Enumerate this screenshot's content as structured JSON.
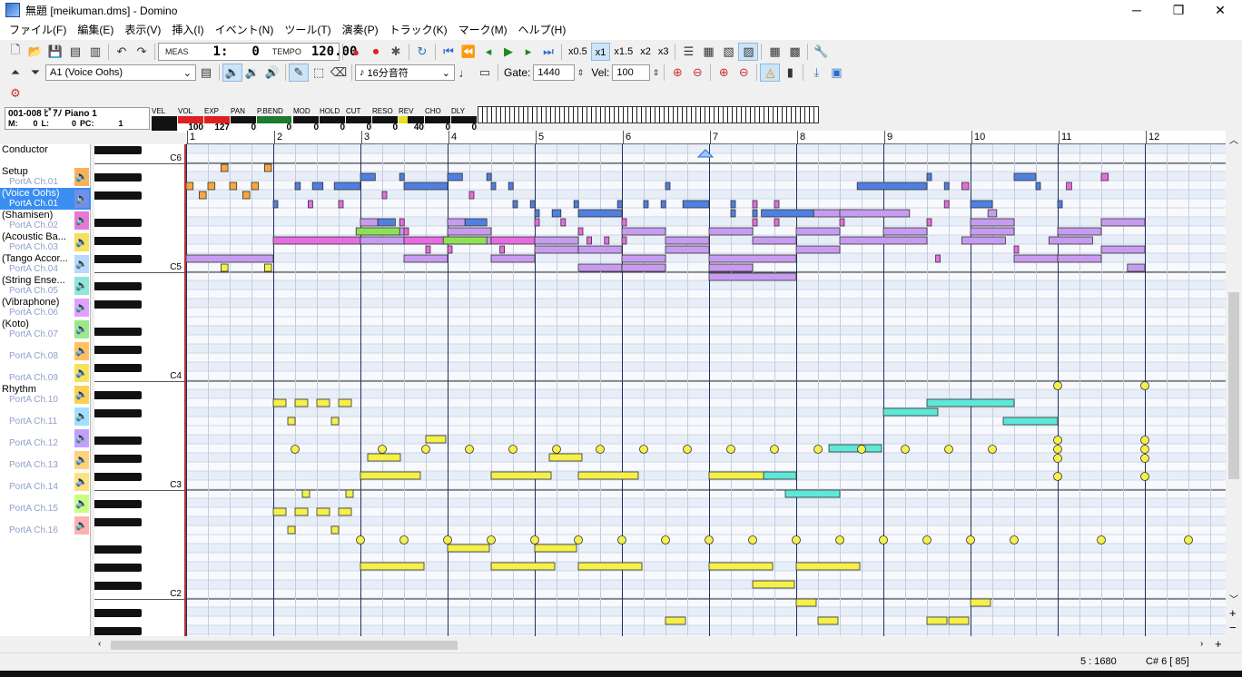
{
  "window": {
    "title": "無題 [meikuman.dms] - Domino",
    "minimize": "─",
    "maximize": "❐",
    "close": "✕"
  },
  "menu": [
    "ファイル(F)",
    "編集(E)",
    "表示(V)",
    "挿入(I)",
    "イベント(N)",
    "ツール(T)",
    "演奏(P)",
    "トラック(K)",
    "マーク(M)",
    "ヘルプ(H)"
  ],
  "toolbar": {
    "meas_label": "MEAS",
    "meas_value": "1:",
    "tick_value": "0",
    "tempo_label": "TEMPO",
    "tempo_value": "120.00",
    "speeds": [
      "x0.5",
      "x1",
      "x1.5",
      "x2",
      "x3"
    ],
    "speed_selected": "x1",
    "track_select": "A1  (Voice Oohs)",
    "note_length": "16分音符",
    "gate_label": "Gate:",
    "gate_value": "1440",
    "vel_label": "Vel:",
    "vel_value": "100"
  },
  "track_info": {
    "name": "001-008 ﾋﾟｱﾉ Piano 1",
    "m_label": "M:",
    "m": "0",
    "l_label": "L:",
    "l": "0",
    "pc_label": "PC:",
    "pc": "1"
  },
  "meters": [
    {
      "label": "VEL",
      "value": ""
    },
    {
      "label": "VOL",
      "value": "100"
    },
    {
      "label": "EXP",
      "value": "127"
    },
    {
      "label": "PAN",
      "value": "0"
    },
    {
      "label": "P.BEND",
      "value": "0"
    },
    {
      "label": "MOD",
      "value": "0"
    },
    {
      "label": "HOLD",
      "value": "0"
    },
    {
      "label": "CUT",
      "value": "0"
    },
    {
      "label": "RESO",
      "value": "0"
    },
    {
      "label": "REV",
      "value": "40"
    },
    {
      "label": "CHO",
      "value": "0"
    },
    {
      "label": "DLY",
      "value": "0"
    }
  ],
  "tracks": [
    {
      "name": "Conductor",
      "port": ""
    },
    {
      "name": "Setup",
      "port": "PortA  Ch.01"
    },
    {
      "name": "(Voice Oohs)",
      "port": "PortA  Ch.01",
      "selected": true
    },
    {
      "name": "(Shamisen)",
      "port": "PortA  Ch.02"
    },
    {
      "name": "(Acoustic Ba...",
      "port": "PortA  Ch.03"
    },
    {
      "name": "(Tango Accor...",
      "port": "PortA  Ch.04"
    },
    {
      "name": "(String Ense...",
      "port": "PortA  Ch.05"
    },
    {
      "name": "(Vibraphone)",
      "port": "PortA  Ch.06"
    },
    {
      "name": "(Koto)",
      "port": "PortA  Ch.07"
    },
    {
      "name": "",
      "port": "PortA  Ch.08"
    },
    {
      "name": "",
      "port": "PortA  Ch.09"
    },
    {
      "name": "Rhythm",
      "port": "PortA  Ch.10"
    },
    {
      "name": "",
      "port": "PortA  Ch.11"
    },
    {
      "name": "",
      "port": "PortA  Ch.12"
    },
    {
      "name": "",
      "port": "PortA  Ch.13"
    },
    {
      "name": "",
      "port": "PortA  Ch.14"
    },
    {
      "name": "",
      "port": "PortA  Ch.15"
    },
    {
      "name": "",
      "port": "PortA  Ch.16"
    }
  ],
  "track_colors": [
    "#ffffff",
    "#f5b25c",
    "#6f8fe8",
    "#e878d8",
    "#f5e060",
    "#b9d8ff",
    "#8ee8d8",
    "#e0a0ff",
    "#9ae88a",
    "#ffc060",
    "#f6e35b",
    "#ffd050",
    "#a0e0ff",
    "#c0a0ff",
    "#ffd27a",
    "#ffe080",
    "#c8ff80",
    "#ffb0b0"
  ],
  "octave_labels": [
    "C6",
    "C5",
    "C4",
    "C3",
    "C2"
  ],
  "measures": [
    "1",
    "2",
    "3",
    "4",
    "5",
    "6",
    "7",
    "8",
    "9",
    "10",
    "11",
    "12"
  ],
  "status": {
    "position": "5 : 1680",
    "note": "C# 6 [ 85]"
  },
  "colors": {
    "orange": "#f5a742",
    "blue": "#4f7fe0",
    "pink": "#e66ce0",
    "purple": "#c79cf0",
    "green": "#8ee05a",
    "cyan": "#5ee8d8",
    "yellow": "#f5f04a"
  },
  "notes": [
    {
      "row": 0,
      "m": 1.4,
      "len": 0.08,
      "c": "orange"
    },
    {
      "row": 0,
      "m": 1.9,
      "len": 0.08,
      "c": "orange"
    },
    {
      "row": 1,
      "m": 3.0,
      "len": 0.17,
      "c": "blue"
    },
    {
      "row": 1,
      "m": 3.45,
      "len": 0.05,
      "c": "blue"
    },
    {
      "row": 1,
      "m": 4.0,
      "len": 0.17,
      "c": "blue"
    },
    {
      "row": 1,
      "m": 4.45,
      "len": 0.05,
      "c": "blue"
    },
    {
      "row": 1,
      "m": 9.5,
      "len": 0.05,
      "c": "blue"
    },
    {
      "row": 1,
      "m": 10.5,
      "len": 0.25,
      "c": "blue"
    },
    {
      "row": 1,
      "m": 11.5,
      "len": 0.08,
      "c": "pink"
    },
    {
      "row": 2,
      "m": 1.0,
      "len": 0.08,
      "c": "orange"
    },
    {
      "row": 2,
      "m": 1.25,
      "len": 0.08,
      "c": "orange"
    },
    {
      "row": 2,
      "m": 1.5,
      "len": 0.08,
      "c": "orange"
    },
    {
      "row": 2,
      "m": 1.75,
      "len": 0.08,
      "c": "orange"
    },
    {
      "row": 2,
      "m": 2.25,
      "len": 0.06,
      "c": "blue"
    },
    {
      "row": 2,
      "m": 2.45,
      "len": 0.12,
      "c": "blue"
    },
    {
      "row": 2,
      "m": 2.7,
      "len": 0.3,
      "c": "blue"
    },
    {
      "row": 2,
      "m": 3.5,
      "len": 0.5,
      "c": "blue"
    },
    {
      "row": 2,
      "m": 4.5,
      "len": 0.05,
      "c": "blue"
    },
    {
      "row": 2,
      "m": 4.7,
      "len": 0.05,
      "c": "blue"
    },
    {
      "row": 2,
      "m": 6.5,
      "len": 0.05,
      "c": "blue"
    },
    {
      "row": 2,
      "m": 8.7,
      "len": 0.8,
      "c": "blue"
    },
    {
      "row": 2,
      "m": 9.7,
      "len": 0.05,
      "c": "blue"
    },
    {
      "row": 2,
      "m": 9.9,
      "len": 0.08,
      "c": "pink"
    },
    {
      "row": 2,
      "m": 10.75,
      "len": 0.05,
      "c": "blue"
    },
    {
      "row": 2,
      "m": 11.1,
      "len": 0.06,
      "c": "pink"
    },
    {
      "row": 3,
      "m": 1.15,
      "len": 0.08,
      "c": "orange"
    },
    {
      "row": 3,
      "m": 1.65,
      "len": 0.08,
      "c": "orange"
    },
    {
      "row": 3,
      "m": 3.25,
      "len": 0.05,
      "c": "pink"
    },
    {
      "row": 3,
      "m": 4.25,
      "len": 0.05,
      "c": "pink"
    },
    {
      "row": 4,
      "m": 2.0,
      "len": 0.05,
      "c": "blue"
    },
    {
      "row": 4,
      "m": 2.4,
      "len": 0.05,
      "c": "pink"
    },
    {
      "row": 4,
      "m": 2.75,
      "len": 0.05,
      "c": "pink"
    },
    {
      "row": 4,
      "m": 4.75,
      "len": 0.05,
      "c": "blue"
    },
    {
      "row": 4,
      "m": 4.95,
      "len": 0.05,
      "c": "blue"
    },
    {
      "row": 4,
      "m": 5.45,
      "len": 0.05,
      "c": "blue"
    },
    {
      "row": 4,
      "m": 5.95,
      "len": 0.05,
      "c": "blue"
    },
    {
      "row": 4,
      "m": 6.25,
      "len": 0.05,
      "c": "blue"
    },
    {
      "row": 4,
      "m": 6.45,
      "len": 0.05,
      "c": "blue"
    },
    {
      "row": 4,
      "m": 6.7,
      "len": 0.3,
      "c": "blue"
    },
    {
      "row": 4,
      "m": 7.25,
      "len": 0.05,
      "c": "blue"
    },
    {
      "row": 4,
      "m": 7.5,
      "len": 0.05,
      "c": "pink"
    },
    {
      "row": 4,
      "m": 7.75,
      "len": 0.05,
      "c": "pink"
    },
    {
      "row": 4,
      "m": 9.7,
      "len": 0.05,
      "c": "pink"
    },
    {
      "row": 4,
      "m": 10.0,
      "len": 0.25,
      "c": "blue"
    },
    {
      "row": 4,
      "m": 11.0,
      "len": 0.05,
      "c": "blue"
    },
    {
      "row": 5,
      "m": 5.0,
      "len": 0.05,
      "c": "blue"
    },
    {
      "row": 5,
      "m": 5.2,
      "len": 0.1,
      "c": "blue"
    },
    {
      "row": 5,
      "m": 5.5,
      "len": 0.5,
      "c": "blue"
    },
    {
      "row": 5,
      "m": 7.25,
      "len": 0.05,
      "c": "blue"
    },
    {
      "row": 5,
      "m": 7.5,
      "len": 0.05,
      "c": "blue"
    },
    {
      "row": 5,
      "m": 7.6,
      "len": 0.6,
      "c": "blue"
    },
    {
      "row": 5,
      "m": 8.2,
      "len": 0.5,
      "c": "purple"
    },
    {
      "row": 5,
      "m": 8.5,
      "len": 0.8,
      "c": "purple"
    },
    {
      "row": 5,
      "m": 10.2,
      "len": 0.1,
      "c": "purple"
    },
    {
      "row": 6,
      "m": 3.0,
      "len": 0.2,
      "c": "purple"
    },
    {
      "row": 6,
      "m": 3.2,
      "len": 0.2,
      "c": "blue"
    },
    {
      "row": 6,
      "m": 3.45,
      "len": 0.05,
      "c": "pink"
    },
    {
      "row": 6,
      "m": 4.0,
      "len": 0.2,
      "c": "purple"
    },
    {
      "row": 6,
      "m": 4.2,
      "len": 0.25,
      "c": "blue"
    },
    {
      "row": 6,
      "m": 5.0,
      "len": 0.05,
      "c": "pink"
    },
    {
      "row": 6,
      "m": 5.3,
      "len": 0.05,
      "c": "pink"
    },
    {
      "row": 6,
      "m": 6.0,
      "len": 0.05,
      "c": "pink"
    },
    {
      "row": 6,
      "m": 7.5,
      "len": 0.05,
      "c": "pink"
    },
    {
      "row": 6,
      "m": 7.75,
      "len": 0.05,
      "c": "pink"
    },
    {
      "row": 6,
      "m": 8.5,
      "len": 0.05,
      "c": "pink"
    },
    {
      "row": 6,
      "m": 9.5,
      "len": 0.05,
      "c": "pink"
    },
    {
      "row": 6,
      "m": 10.0,
      "len": 0.5,
      "c": "purple"
    },
    {
      "row": 6,
      "m": 11.5,
      "len": 0.5,
      "c": "purple"
    },
    {
      "row": 7,
      "m": 3.0,
      "len": 0.5,
      "c": "purple"
    },
    {
      "row": 7,
      "m": 3.5,
      "len": 0.05,
      "c": "pink"
    },
    {
      "row": 7,
      "m": 4.0,
      "len": 0.5,
      "c": "purple"
    },
    {
      "row": 7,
      "m": 5.5,
      "len": 0.05,
      "c": "pink"
    },
    {
      "row": 7,
      "m": 6.0,
      "len": 0.5,
      "c": "purple"
    },
    {
      "row": 7,
      "m": 7.0,
      "len": 0.5,
      "c": "purple"
    },
    {
      "row": 7,
      "m": 8.0,
      "len": 0.5,
      "c": "purple"
    },
    {
      "row": 7,
      "m": 9.0,
      "len": 0.5,
      "c": "purple"
    },
    {
      "row": 7,
      "m": 10.0,
      "len": 0.5,
      "c": "purple"
    },
    {
      "row": 7,
      "m": 11.0,
      "len": 0.5,
      "c": "purple"
    },
    {
      "row": 8,
      "m": 2.0,
      "len": 1.0,
      "c": "pink"
    },
    {
      "row": 8,
      "m": 3.0,
      "len": 0.5,
      "c": "purple"
    },
    {
      "row": 8,
      "m": 3.5,
      "len": 0.5,
      "c": "pink"
    },
    {
      "row": 8,
      "m": 4.0,
      "len": 0.5,
      "c": "purple"
    },
    {
      "row": 8,
      "m": 4.5,
      "len": 0.5,
      "c": "pink"
    },
    {
      "row": 8,
      "m": 5.0,
      "len": 0.5,
      "c": "purple"
    },
    {
      "row": 8,
      "m": 5.6,
      "len": 0.05,
      "c": "pink"
    },
    {
      "row": 8,
      "m": 5.8,
      "len": 0.05,
      "c": "pink"
    },
    {
      "row": 8,
      "m": 6.0,
      "len": 0.05,
      "c": "pink"
    },
    {
      "row": 8,
      "m": 6.5,
      "len": 0.5,
      "c": "purple"
    },
    {
      "row": 8,
      "m": 7.5,
      "len": 0.5,
      "c": "purple"
    },
    {
      "row": 8,
      "m": 8.5,
      "len": 1.0,
      "c": "purple"
    },
    {
      "row": 8,
      "m": 9.9,
      "len": 0.5,
      "c": "purple"
    },
    {
      "row": 8,
      "m": 10.9,
      "len": 0.5,
      "c": "purple"
    },
    {
      "row": 7,
      "m": 2.95,
      "len": 0.5,
      "c": "green"
    },
    {
      "row": 8,
      "m": 3.95,
      "len": 0.5,
      "c": "green"
    },
    {
      "row": 9,
      "m": 3.75,
      "len": 0.05,
      "c": "pink"
    },
    {
      "row": 9,
      "m": 4.0,
      "len": 0.05,
      "c": "pink"
    },
    {
      "row": 9,
      "m": 4.6,
      "len": 0.05,
      "c": "pink"
    },
    {
      "row": 9,
      "m": 5.0,
      "len": 0.5,
      "c": "purple"
    },
    {
      "row": 9,
      "m": 5.5,
      "len": 0.5,
      "c": "purple"
    },
    {
      "row": 9,
      "m": 6.5,
      "len": 0.5,
      "c": "purple"
    },
    {
      "row": 9,
      "m": 8.0,
      "len": 0.5,
      "c": "purple"
    },
    {
      "row": 9,
      "m": 10.5,
      "len": 0.05,
      "c": "pink"
    },
    {
      "row": 9,
      "m": 11.5,
      "len": 0.5,
      "c": "purple"
    },
    {
      "row": 10,
      "m": 1.0,
      "len": 1.0,
      "c": "purple"
    },
    {
      "row": 10,
      "m": 3.5,
      "len": 0.5,
      "c": "purple"
    },
    {
      "row": 10,
      "m": 4.5,
      "len": 0.5,
      "c": "purple"
    },
    {
      "row": 10,
      "m": 6.0,
      "len": 0.5,
      "c": "purple"
    },
    {
      "row": 10,
      "m": 7.0,
      "len": 1.0,
      "c": "purple"
    },
    {
      "row": 10,
      "m": 9.6,
      "len": 0.05,
      "c": "pink"
    },
    {
      "row": 10,
      "m": 10.5,
      "len": 0.5,
      "c": "purple"
    },
    {
      "row": 10,
      "m": 11.0,
      "len": 0.5,
      "c": "purple"
    },
    {
      "row": 11,
      "m": 1.4,
      "len": 0.08,
      "c": "yellow"
    },
    {
      "row": 11,
      "m": 1.9,
      "len": 0.08,
      "c": "yellow"
    },
    {
      "row": 11,
      "m": 5.5,
      "len": 0.5,
      "c": "purple"
    },
    {
      "row": 11,
      "m": 6.0,
      "len": 0.5,
      "c": "purple"
    },
    {
      "row": 11,
      "m": 7.0,
      "len": 0.5,
      "c": "purple"
    },
    {
      "row": 11,
      "m": 11.8,
      "len": 0.2,
      "c": "purple"
    },
    {
      "row": 12,
      "m": 7.0,
      "len": 1.0,
      "c": "purple"
    }
  ]
}
